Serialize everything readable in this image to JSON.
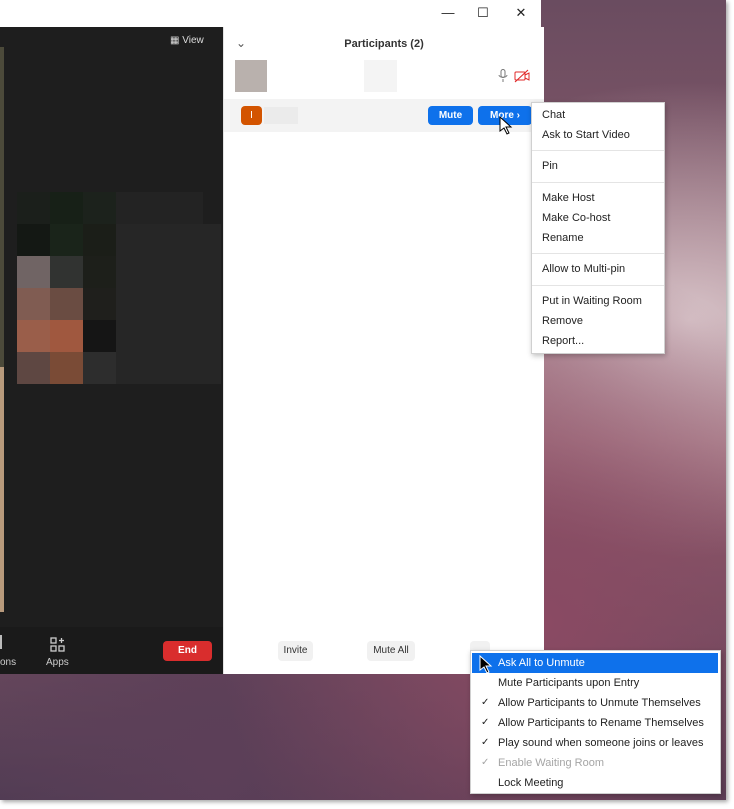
{
  "window": {
    "controls": {
      "minimize": "—",
      "maximize": "☐",
      "close": "✕"
    }
  },
  "video": {
    "view_label": "View",
    "toolbar": {
      "apps_label": "Apps",
      "options_partial": "ons",
      "end_label": "End"
    }
  },
  "panel": {
    "title": "Participants (2)",
    "collapse_glyph": "⌄",
    "participants": [
      {
        "avatar_initial": "",
        "muted": false,
        "video_off": true
      },
      {
        "avatar_initial": "I",
        "avatar_color": "#d35400",
        "mute_label": "Mute",
        "more_label": "More ›"
      }
    ],
    "bottom": {
      "invite_label": "Invite",
      "mute_all_label": "Mute All"
    }
  },
  "more_menu": {
    "items": [
      {
        "label": "Chat"
      },
      {
        "label": "Ask to Start Video"
      },
      {
        "label": "Pin"
      },
      {
        "label": "Make Host"
      },
      {
        "label": "Make Co-host"
      },
      {
        "label": "Rename"
      },
      {
        "label": "Allow to Multi-pin"
      },
      {
        "label": "Put in Waiting Room"
      },
      {
        "label": "Remove"
      },
      {
        "label": "Report..."
      }
    ]
  },
  "options_menu": {
    "items": [
      {
        "label": "Ask All to Unmute",
        "checked": false,
        "highlighted": true,
        "disabled": false
      },
      {
        "label": "Mute Participants upon Entry",
        "checked": false,
        "highlighted": false,
        "disabled": false
      },
      {
        "label": "Allow Participants to Unmute Themselves",
        "checked": true,
        "highlighted": false,
        "disabled": false
      },
      {
        "label": "Allow Participants to Rename Themselves",
        "checked": true,
        "highlighted": false,
        "disabled": false
      },
      {
        "label": "Play sound when someone joins or leaves",
        "checked": true,
        "highlighted": false,
        "disabled": false
      },
      {
        "label": "Enable Waiting Room",
        "checked": true,
        "highlighted": false,
        "disabled": true
      },
      {
        "label": "Lock Meeting",
        "checked": false,
        "highlighted": false,
        "disabled": false
      }
    ],
    "check_glyph": "✓"
  },
  "colors": {
    "accent": "#0e71eb",
    "end_red": "#d92d2d",
    "avatar_orange": "#d35400"
  }
}
